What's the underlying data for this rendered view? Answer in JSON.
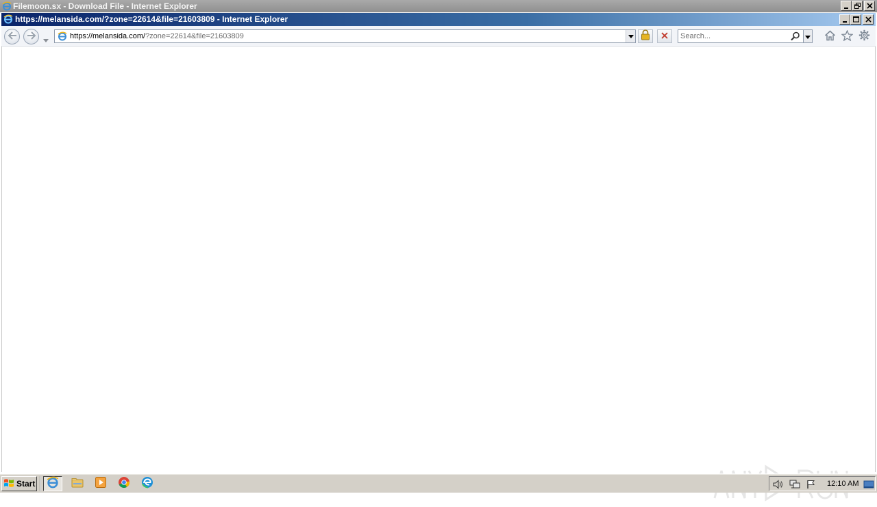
{
  "outer_window": {
    "title": "Filemoon.sx - Download File - Internet Explorer"
  },
  "inner_window": {
    "title": "https://melansida.com/?zone=22614&file=21603809 - Internet Explorer"
  },
  "address_bar": {
    "host_part": "https://melansida.com/",
    "rest_part": "?zone=22614&file=21603809",
    "icon": "ie-page-icon"
  },
  "search": {
    "placeholder": "Search..."
  },
  "toolbar_icons": [
    "back-icon",
    "forward-icon",
    "lock-icon",
    "stop-icon",
    "search-icon",
    "home-icon",
    "favorites-star-icon",
    "gear-icon"
  ],
  "watermark": {
    "text": "ANY.RUN"
  },
  "taskbar": {
    "start_label": "Start",
    "apps": [
      "internet-explorer",
      "file-explorer",
      "media-player",
      "chrome",
      "edge"
    ],
    "clock": "12:10 AM"
  },
  "colors": {
    "active_title": "#0a246a",
    "inactive_title": "#8f8f8f",
    "taskbar": "#d4d0c8"
  }
}
